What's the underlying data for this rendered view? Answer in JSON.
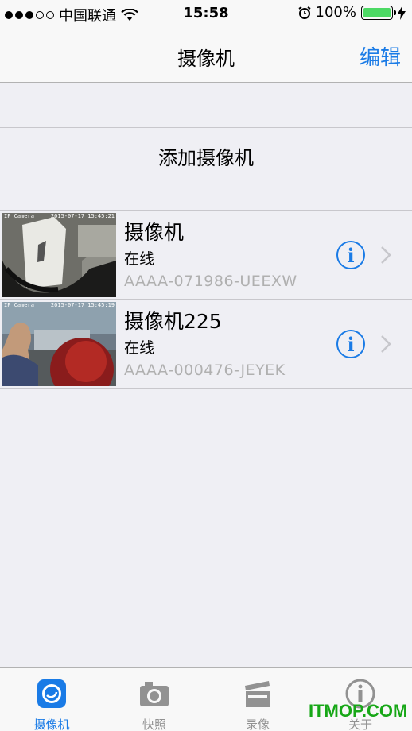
{
  "status_bar": {
    "carrier": "中国联通",
    "time": "15:58",
    "battery": "100%"
  },
  "nav": {
    "title": "摄像机",
    "edit_label": "编辑"
  },
  "add_camera_label": "添加摄像机",
  "cameras": [
    {
      "name": "摄像机",
      "status": "在线",
      "uid": "AAAA-071986-UEEXW",
      "stamp_left": "IP Camera",
      "stamp_right": "2015-07-17 15:45:21"
    },
    {
      "name": "摄像机225",
      "status": "在线",
      "uid": "AAAA-000476-JEYEK",
      "stamp_left": "IP Camera",
      "stamp_right": "2015-07-17 15:45:19"
    }
  ],
  "tabs": [
    {
      "label": "摄像机",
      "icon": "camera-lens-icon",
      "active": true
    },
    {
      "label": "快照",
      "icon": "photo-camera-icon",
      "active": false
    },
    {
      "label": "录像",
      "icon": "clapperboard-icon",
      "active": false
    },
    {
      "label": "关于",
      "icon": "info-icon",
      "active": false
    }
  ],
  "watermark": "ITMOP.COM",
  "colors": {
    "accent": "#1a7be6",
    "background": "#efeff4",
    "battery": "#4cd964",
    "uid_gray": "#b0b0b0"
  }
}
